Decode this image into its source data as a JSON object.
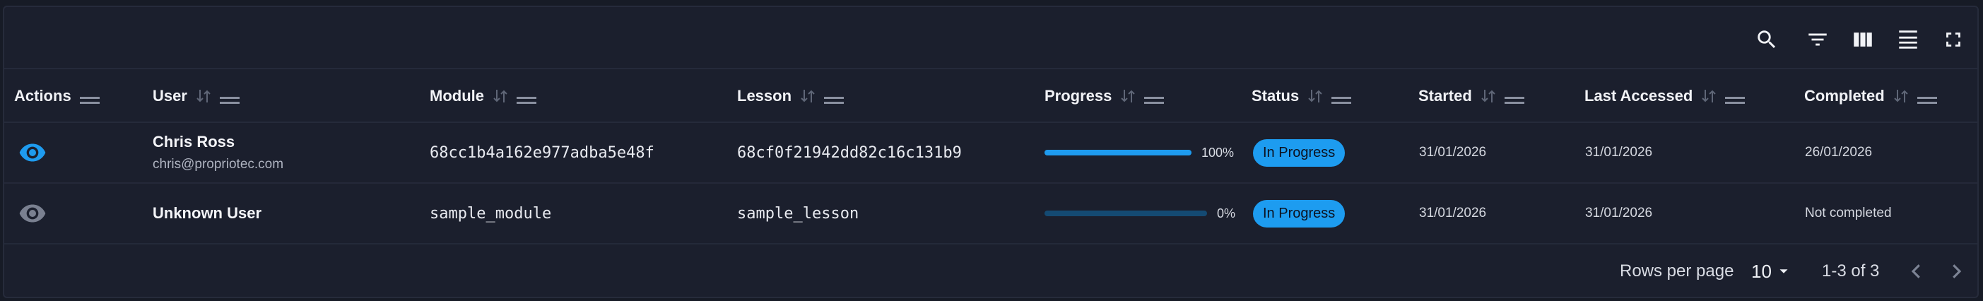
{
  "toolbar": {
    "icons": [
      "search-icon",
      "filter-icon",
      "columns-icon",
      "density-icon",
      "fullscreen-icon"
    ]
  },
  "columns": [
    {
      "label": "Actions",
      "sortable": false
    },
    {
      "label": "User",
      "sortable": true
    },
    {
      "label": "Module",
      "sortable": true
    },
    {
      "label": "Lesson",
      "sortable": true
    },
    {
      "label": "Progress",
      "sortable": true
    },
    {
      "label": "Status",
      "sortable": true
    },
    {
      "label": "Started",
      "sortable": true
    },
    {
      "label": "Last Accessed",
      "sortable": true
    },
    {
      "label": "Completed",
      "sortable": true
    }
  ],
  "rows": [
    {
      "user_name": "Chris Ross",
      "user_email": "chris@propriotec.com",
      "module": "68cc1b4a162e977adba5e48f",
      "lesson": "68cf0f21942dd82c16c131b9",
      "progress": 100,
      "progress_label": "100%",
      "status": "In Progress",
      "started": "31/01/2026",
      "last_accessed": "31/01/2026",
      "completed": "26/01/2026",
      "view_active": true
    },
    {
      "user_name": "Unknown User",
      "user_email": "",
      "module": "sample_module",
      "lesson": "sample_lesson",
      "progress": 0,
      "progress_label": "0%",
      "status": "In Progress",
      "started": "31/01/2026",
      "last_accessed": "31/01/2026",
      "completed": "Not completed",
      "view_active": false
    }
  ],
  "footer": {
    "rows_per_page_label": "Rows per page",
    "rows_per_page_value": "10",
    "range_label": "1-3 of 3"
  },
  "colors": {
    "accent": "#1e9bef",
    "background": "#1b1f2d",
    "eye_active": "#1e9bef",
    "eye_inactive": "#7a8090"
  }
}
